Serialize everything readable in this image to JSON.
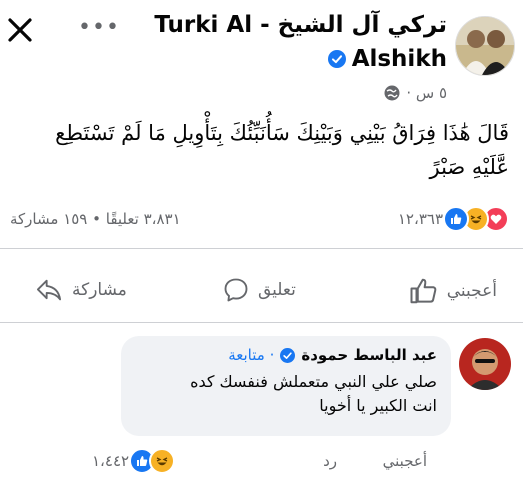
{
  "header": {
    "author_name_line1": "تركي آل الشيخ - Turki Al",
    "author_name_line2": "Alshikh",
    "time": "٥ س ·",
    "more_label": "•••"
  },
  "post": {
    "text": "قَالَ هَٰذَا فِرَاقُ بَيْنِي وَبَيْنِكَ سَأُنَبِّئُكَ بِتَأْوِيلِ مَا لَمْ تَسْتَطِع عَّلَيْهِ صَبْرً"
  },
  "stats": {
    "reaction_count": "١٢،٣٦٣",
    "comments_shares": "٣،٨٣١ تعليقًا • ١٥٩ مشاركة"
  },
  "actions": {
    "like": "أعجبني",
    "comment": "تعليق",
    "share": "مشاركة"
  },
  "comment": {
    "author": "عبد الباسط حمودة",
    "follow": "· متابعة",
    "line1": "صلي علي النبي متعملش فنفسك كده",
    "line2": "انت الكبير يا أخويا",
    "like": "أعجبني",
    "reply": "رد",
    "reaction_count": "١،٤٤٢"
  },
  "colors": {
    "brand_blue": "#1877f2",
    "muted": "#65676b",
    "bubble": "#f0f2f5"
  },
  "icons": [
    "close-icon",
    "globe-icon",
    "verified-icon",
    "like-icon",
    "comment-icon",
    "share-icon",
    "like-reaction-icon",
    "haha-reaction-icon",
    "love-reaction-icon"
  ]
}
